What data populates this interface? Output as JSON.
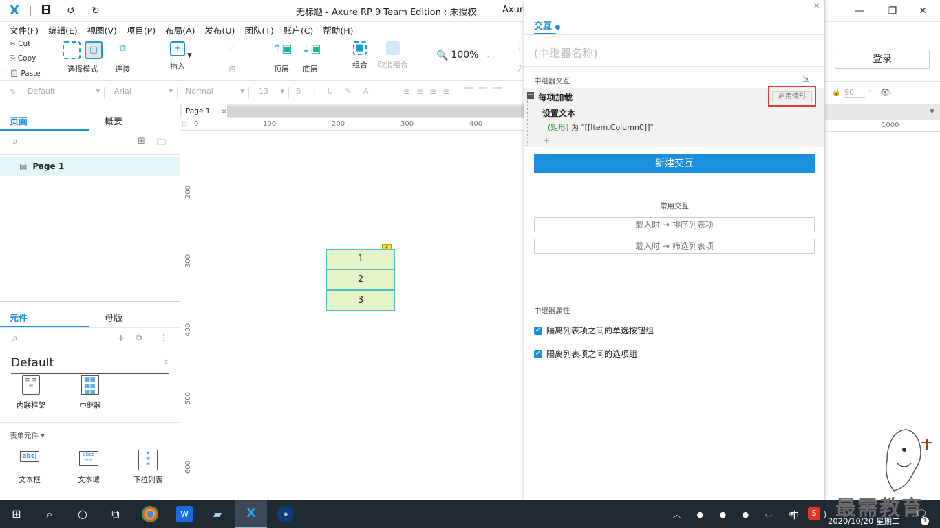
{
  "titlebar": {
    "title": "无标题 - Axure RP 9 Team Edition : 未授权",
    "title_tail": "Axure",
    "logo": "X"
  },
  "menu": [
    "文件(F)",
    "编辑(E)",
    "视图(V)",
    "项目(P)",
    "布局(A)",
    "发布(U)",
    "团队(T)",
    "账户(C)",
    "帮助(H)"
  ],
  "clipboard": {
    "cut": "Cut",
    "copy": "Copy",
    "paste": "Paste"
  },
  "tools": {
    "select_mode": "选择模式",
    "connect": "连接",
    "insert": "插入",
    "point": "点",
    "top": "顶层",
    "bottom": "底层",
    "group": "组合",
    "ungroup": "取消组合",
    "left": "左",
    "zoom": "100%"
  },
  "login": "登录",
  "format": {
    "style": "Default",
    "font": "Arial",
    "weight": "Normal",
    "size": "13",
    "h_value": "90",
    "h_label": "H"
  },
  "left_pane": {
    "tab_pages": "页面",
    "tab_outline": "概要",
    "page1": "Page 1",
    "tab_widgets": "元件",
    "tab_masters": "母版",
    "library": "Default",
    "widgets": [
      "内联框架",
      "中继器"
    ],
    "form_section": "表单元件",
    "form_widgets": [
      "文本框",
      "文本域",
      "下拉列表"
    ]
  },
  "canvas": {
    "tab": "Page 1",
    "ruler_h": [
      "0",
      "100",
      "200",
      "300",
      "400",
      "1000"
    ],
    "ruler_v": [
      "200",
      "300",
      "400",
      "500",
      "600"
    ],
    "repeater_rows": [
      "1",
      "2",
      "3"
    ]
  },
  "interactions": {
    "tab": "交互",
    "name_placeholder": "(中继器名称)",
    "section": "中继器交互",
    "event": "每项加载",
    "enable_case": "启用情形",
    "action": "设置文本",
    "target": "(矩形)",
    "to": "为",
    "value": "\"[[Item.Column0]]\"",
    "plus": "+",
    "new_interaction": "新建交互",
    "common": "常用交互",
    "common1": "载入时 → 排序列表项",
    "common2": "载入时 → 筛选列表项",
    "props": "中继器属性",
    "check1": "隔离列表项之间的单选按钮组",
    "check2": "隔离列表项之间的选项组"
  },
  "taskbar": {
    "ime": "中",
    "date": "2020/10/20 星期二",
    "notif": "1",
    "watermark": "最需教育"
  },
  "colors": {
    "accent": "#1c8fdd",
    "repeater_fill": "#e6f5c9",
    "repeater_border": "#4fc3c3",
    "highlight_box": "#e53935"
  }
}
